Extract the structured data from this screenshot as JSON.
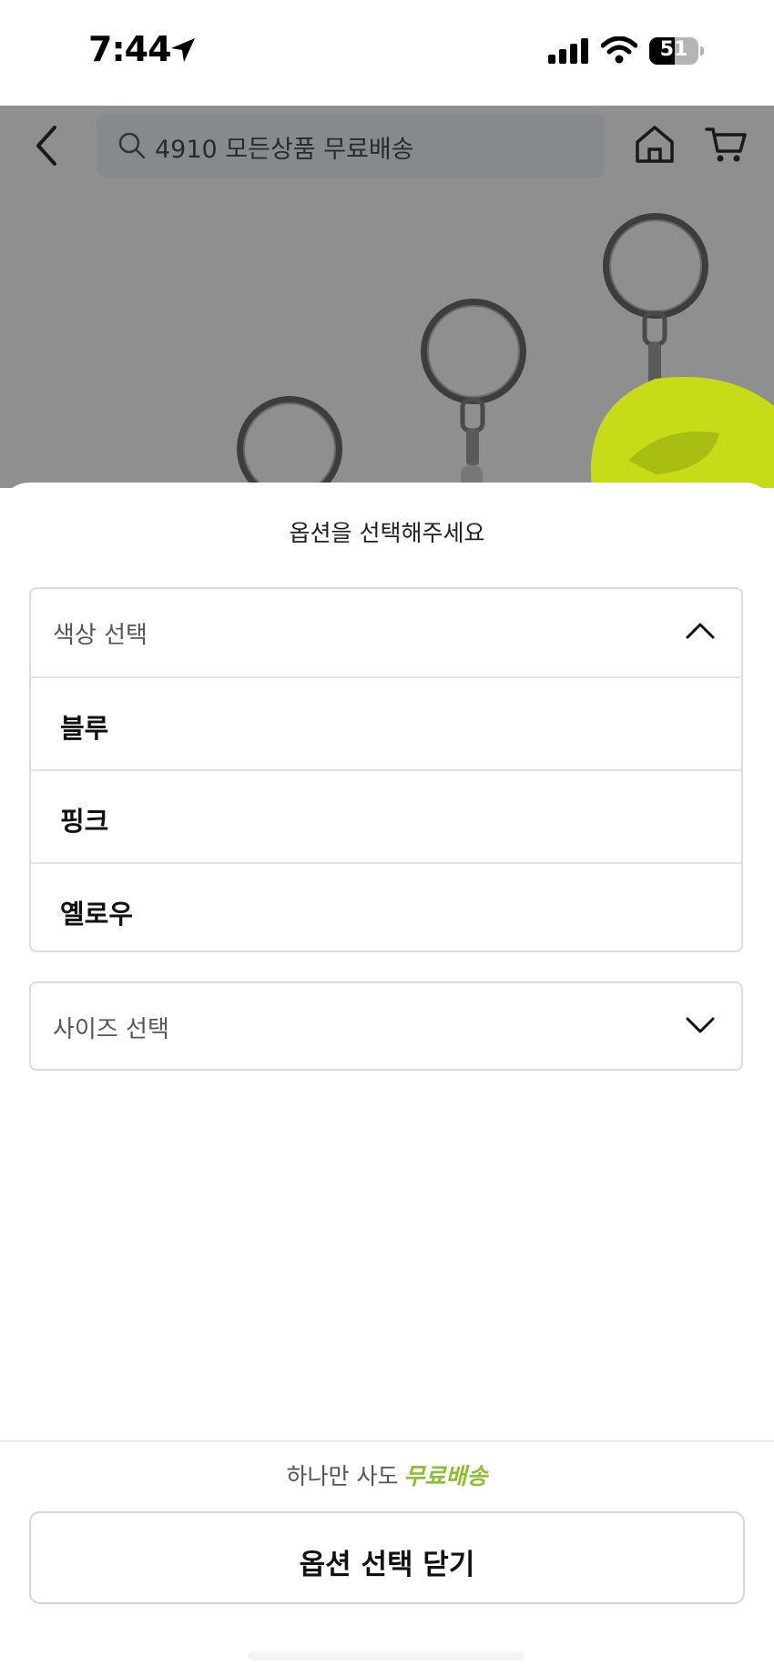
{
  "status_bar": {
    "time": "7:44",
    "battery_level": "51"
  },
  "search": {
    "text": "4910 모든상품 무료배송"
  },
  "sheet": {
    "title": "옵션을 선택해주세요",
    "color_dropdown": {
      "label": "색상 선택",
      "expanded": true,
      "options": [
        "블루",
        "핑크",
        "옐로우"
      ]
    },
    "size_dropdown": {
      "label": "사이즈 선택",
      "expanded": false
    },
    "promo_prefix": "하나만 사도",
    "promo_highlight": "무료배송",
    "close_button_label": "옵션 선택 닫기"
  },
  "colors": {
    "accent_green": "#8ac02d",
    "dim_overlay": "#8f8f8f"
  }
}
